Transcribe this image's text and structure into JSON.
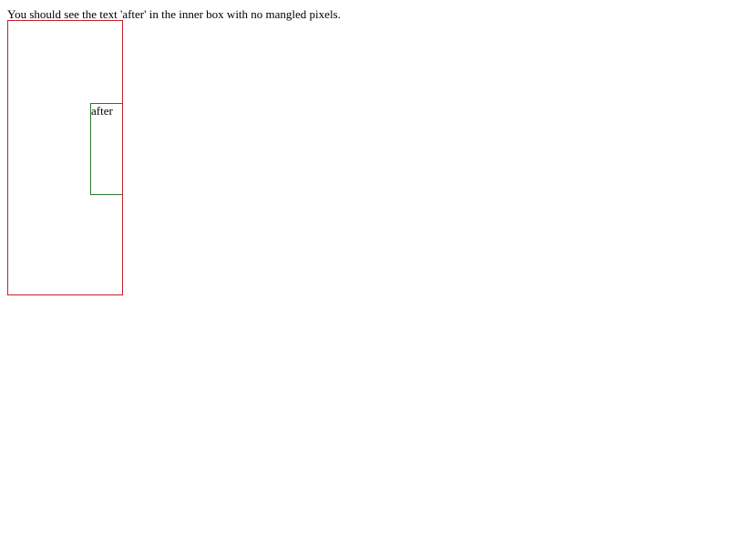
{
  "instruction": "You should see the text 'after' in the inner box with no mangled pixels.",
  "inner_box": {
    "text": "after"
  },
  "colors": {
    "outer_border": "#c8202a",
    "inner_border": "#2a7a2a",
    "background": "#ffffff",
    "text": "#000000"
  }
}
